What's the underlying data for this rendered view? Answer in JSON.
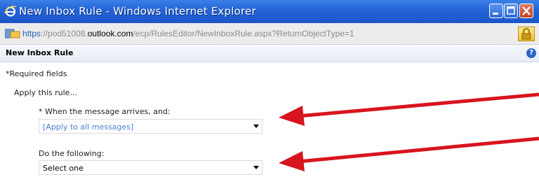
{
  "window": {
    "title": "New Inbox Rule - Windows Internet Explorer",
    "buttons": {
      "minimize": "minimize",
      "maximize": "maximize",
      "close": "close"
    }
  },
  "address": {
    "scheme": "https",
    "prefix": "://pod51008.",
    "domain": "outlook.com",
    "path": "/ecp/RulesEditor/NewInboxRule.aspx?ReturnObjectType=1"
  },
  "page": {
    "title": "New Inbox Rule",
    "help_label": "?"
  },
  "form": {
    "required_note": "*Required fields",
    "apply_heading": "Apply this rule...",
    "condition_label": "* When the message arrives, and:",
    "condition_value": "[Apply to all messages]",
    "action_label": "Do the following:",
    "action_value": "Select one"
  },
  "colors": {
    "annotation_arrow": "#d8141e",
    "condition_value": "#4a7fd0"
  }
}
